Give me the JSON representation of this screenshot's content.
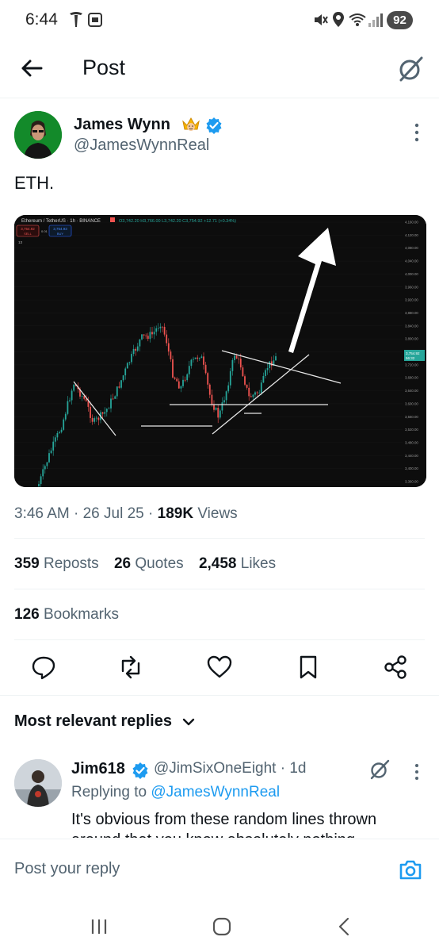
{
  "status_bar": {
    "time": "6:44",
    "battery": "92"
  },
  "header": {
    "title": "Post"
  },
  "author": {
    "name": "James Wynn",
    "handle": "@JamesWynnReal"
  },
  "post": {
    "text": "ETH."
  },
  "chart": {
    "header_text": "Ethereum / TetherUS · 1h · BINANCE",
    "ohlc_text": "O3,742.20 H3,766.00 L3,742.20 C3,754.92 +12.71 (+0.34%)",
    "sell_price": "3,754.92",
    "sell_label": "SELL",
    "spread": "0.01",
    "buy_price": "3,754.93",
    "buy_label": "BUY",
    "indicator_count": "13",
    "price_tag": "3,754.92",
    "price_tag_time": "56:32",
    "y_ticks": [
      "4,160.00",
      "4,120.00",
      "4,080.00",
      "4,040.00",
      "4,000.00",
      "3,960.00",
      "3,920.00",
      "3,880.00",
      "3,840.00",
      "3,800.00",
      "3,760.00",
      "3,720.00",
      "3,680.00",
      "3,640.00",
      "3,600.00",
      "3,560.00",
      "3,520.00",
      "3,480.00",
      "3,440.00",
      "3,400.00",
      "3,360.00"
    ]
  },
  "meta": {
    "time": "3:46 AM",
    "date": "26 Jul 25",
    "views_count": "189K",
    "views_label": "Views"
  },
  "stats": {
    "reposts": "359",
    "reposts_label": "Reposts",
    "quotes": "26",
    "quotes_label": "Quotes",
    "likes": "2,458",
    "likes_label": "Likes",
    "bookmarks": "126",
    "bookmarks_label": "Bookmarks"
  },
  "replies": {
    "section_title": "Most relevant replies",
    "items": [
      {
        "name": "Jim618",
        "handle": "@JimSixOneEight",
        "age": "· 1d",
        "replying_prefix": "Replying to",
        "replying_to": "@JamesWynnReal",
        "text": "It's obvious from these random lines thrown around that you know absolutely nothing"
      }
    ]
  },
  "compose": {
    "placeholder": "Post your reply"
  },
  "colors": {
    "accent": "#1d9bf0",
    "text": "#0f1419",
    "muted": "#536471",
    "up_candle": "#26a69a",
    "down_candle": "#ef5350"
  }
}
